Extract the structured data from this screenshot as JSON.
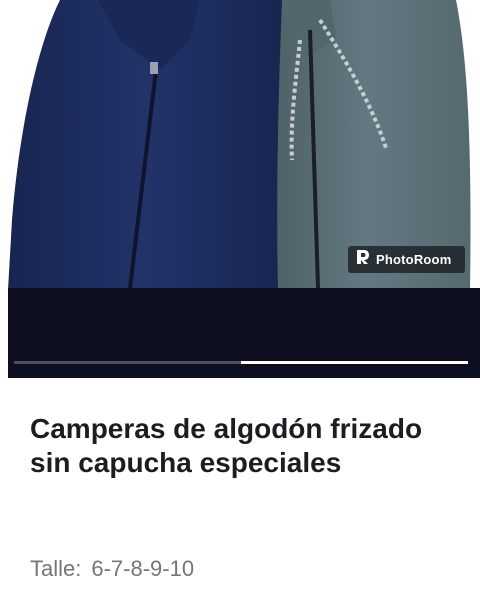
{
  "gallery": {
    "watermark": {
      "brand_text": "PhotoRoom",
      "icon": "photoroom-logo-icon"
    },
    "progress": {
      "segments": 2,
      "active_segment": 2
    }
  },
  "product": {
    "title": "Camperas de algodón frizado sin capucha especiales",
    "size_label": "Talle:",
    "size_value": "6-7-8-9-10"
  },
  "colors": {
    "navy_jacket": "#1f2e5e",
    "gray_jacket": "#5d7178",
    "overlay": "#0d0e1f",
    "title_text": "#1b1d22",
    "muted_text": "#73767a"
  }
}
